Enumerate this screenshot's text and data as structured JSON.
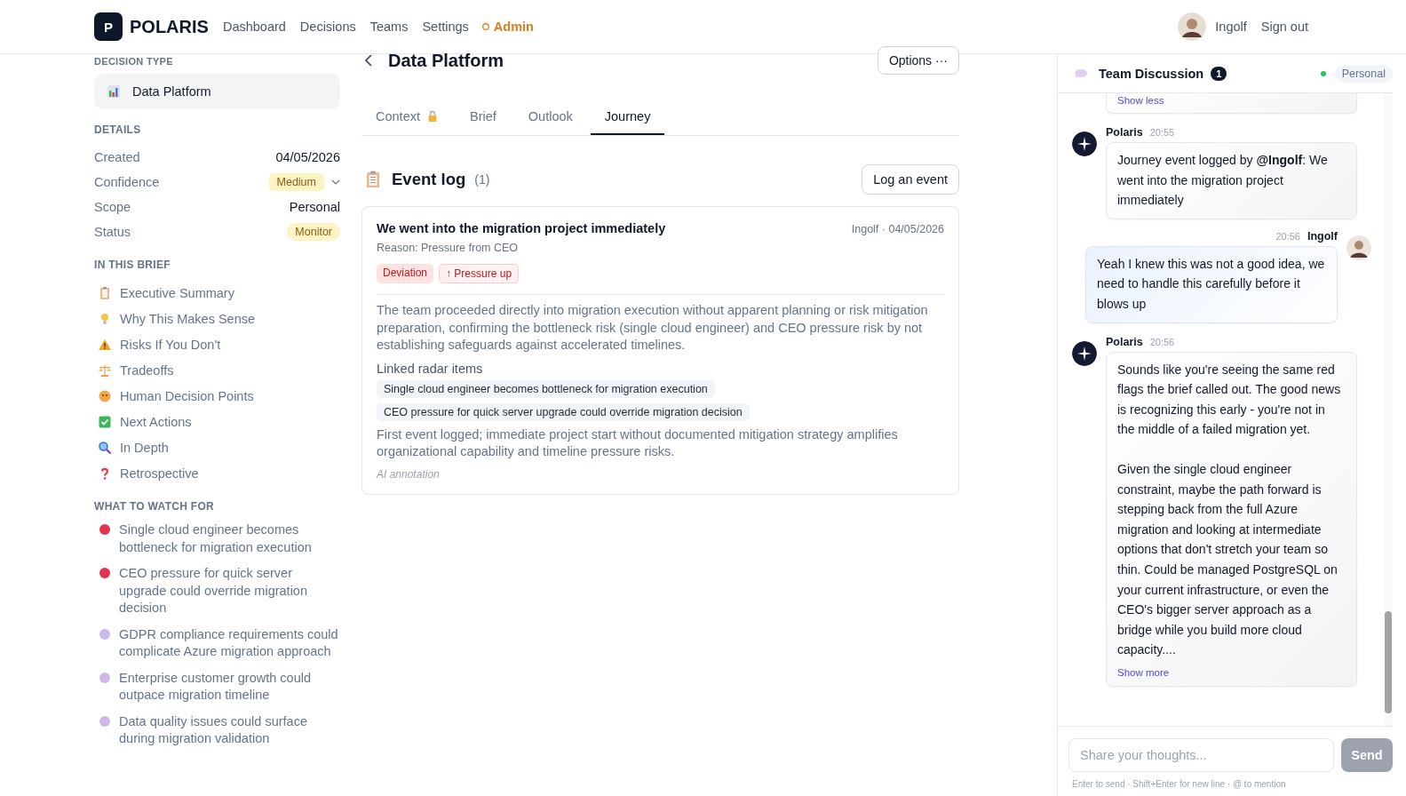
{
  "nav": {
    "logo_letter": "P",
    "brand": "POLARIS",
    "links": [
      {
        "label": "Dashboard",
        "kind": "link"
      },
      {
        "label": "Decisions",
        "kind": "link"
      },
      {
        "label": "Teams",
        "kind": "link"
      },
      {
        "label": "Settings",
        "kind": "link"
      },
      {
        "label": "Admin",
        "kind": "admin"
      }
    ],
    "user": "Ingolf",
    "signout": "Sign out"
  },
  "sidebar": {
    "decision_type_heading": "DECISION TYPE",
    "decision_type": "Data Platform",
    "details_heading": "DETAILS",
    "details": [
      {
        "label": "Created",
        "value": "04/05/2026",
        "kind": "text"
      },
      {
        "label": "Confidence",
        "value": "Medium",
        "kind": "select"
      },
      {
        "label": "Scope",
        "value": "Personal",
        "kind": "text"
      },
      {
        "label": "Status",
        "value": "Monitor",
        "kind": "pill"
      }
    ],
    "brief_heading": "IN THIS BRIEF",
    "brief_items": [
      "Executive Summary",
      "Why This Makes Sense",
      "Risks If You Don't",
      "Tradeoffs",
      "Human Decision Points",
      "Next Actions",
      "In Depth",
      "Retrospective"
    ],
    "watch_heading": "WHAT TO WATCH FOR",
    "watch_items": [
      {
        "text": "Single cloud engineer becomes bottleneck for migration execution",
        "color": "#e0354d"
      },
      {
        "text": "CEO pressure for quick server upgrade could override migration decision",
        "color": "#e0354d"
      },
      {
        "text": "GDPR compliance requirements could complicate Azure migration approach",
        "color": "#cdb8e6"
      },
      {
        "text": "Enterprise customer growth could outpace migration timeline",
        "color": "#cdb8e6"
      },
      {
        "text": "Data quality issues could surface during migration validation",
        "color": "#cdb8e6"
      }
    ]
  },
  "main": {
    "title": "Data Platform",
    "options": "Options ···",
    "tabs": [
      {
        "label": "Context",
        "selected": false,
        "locked": true
      },
      {
        "label": "Brief",
        "selected": false,
        "locked": false
      },
      {
        "label": "Outlook",
        "selected": false,
        "locked": false
      },
      {
        "label": "Journey",
        "selected": true,
        "locked": false
      }
    ],
    "event_log": {
      "title": "Event log",
      "count": "(1)",
      "button": "Log an event",
      "events": [
        {
          "title": "We went into the migration project immediately",
          "meta": "Ingolf · 04/05/2026",
          "reason": "Reason: Pressure from CEO",
          "tags": [
            {
              "label": "Deviation",
              "kind": "deviation"
            },
            {
              "label": "↑ Pressure up",
              "kind": "pressure"
            }
          ],
          "summary": "The team proceeded directly into migration execution without apparent planning or risk mitigation preparation, confirming the bottleneck risk (single cloud engineer) and CEO pressure risk by not establishing safeguards against accelerated timelines.",
          "linked_heading": "Linked radar items",
          "linked": [
            "Single cloud engineer becomes bottleneck for migration execution",
            "CEO pressure for quick server upgrade could override migration decision"
          ],
          "note": "First event logged; immediate project start without documented mitigation strategy amplifies organizational capability and timeline pressure risks.",
          "annotation": "AI annotation"
        }
      ]
    }
  },
  "chat": {
    "title": "Team Discussion",
    "badge": "1",
    "online": true,
    "scope": "Personal",
    "messages": [
      {
        "kind": "fragment",
        "link": "Show less"
      },
      {
        "kind": "bot",
        "author": "Polaris",
        "time": "20:55",
        "paragraphs": [
          "Journey event logged by **@Ingolf**: We went into the migration project immediately"
        ]
      },
      {
        "kind": "user",
        "author": "Ingolf",
        "time": "20:56",
        "paragraphs": [
          "Yeah I knew this was not a good idea, we need to handle this carefully before it blows up"
        ]
      },
      {
        "kind": "bot",
        "author": "Polaris",
        "time": "20:56",
        "paragraphs": [
          "Sounds like you're seeing the same red flags the brief called out. The good news is recognizing this early - you're not in the middle of a failed migration yet.",
          "Given the single cloud engineer constraint, maybe the path forward is stepping back from the full Azure migration and looking at intermediate options that don't stretch your team so thin. Could be managed PostgreSQL on your current infrastructure, or even the CEO's bigger server approach as a bridge while you build more cloud capacity...."
        ],
        "link": "Show more"
      }
    ],
    "input": {
      "placeholder": "Share your thoughts...",
      "send": "Send",
      "send_disabled": true
    },
    "hint": "Enter to send · Shift+Enter for new line · @ to mention"
  }
}
